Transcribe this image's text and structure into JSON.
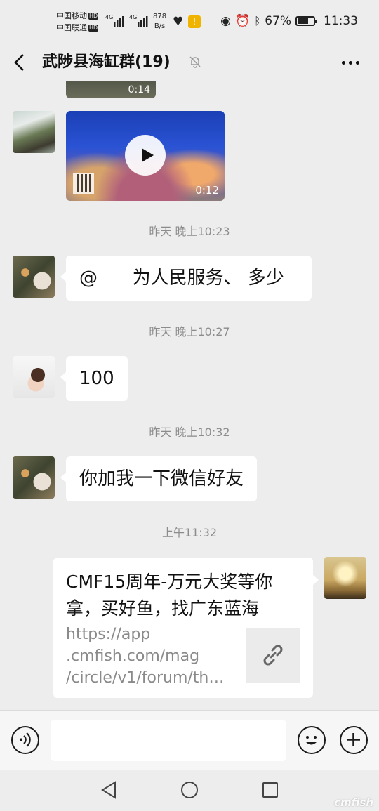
{
  "status_bar": {
    "carrier1": "中国移动",
    "carrier2": "中国联通",
    "hd": "HD",
    "net_type": "4G",
    "net_speed_value": "878",
    "net_speed_unit": "B/s",
    "battery": "67%",
    "battery_level": 0.67,
    "time": "11:33"
  },
  "header": {
    "title": "武陟县海缸群(19)"
  },
  "messages": {
    "video1": {
      "duration": "0:14"
    },
    "video2": {
      "duration": "0:12"
    },
    "time1": "昨天 晚上10:23",
    "msg1": "@      为人民服务、 多少",
    "time2": "昨天 晚上10:27",
    "msg2": "100",
    "time3": "昨天 晚上10:32",
    "msg3": "你加我一下微信好友",
    "time4": "上午11:32",
    "link": {
      "title": "CMF15周年-万元大奖等你拿，买好鱼，找广东蓝海",
      "url": "https://app\n.cmfish.com/mag\n/circle/v1/forum/th…"
    }
  },
  "watermark": "cmfish"
}
